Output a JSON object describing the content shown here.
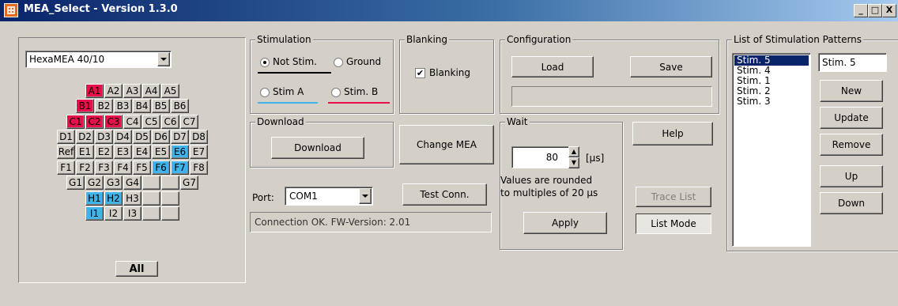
{
  "window": {
    "title": "MEA_Select - Version 1.3.0",
    "min": "_",
    "max": "□",
    "close": "X"
  },
  "mea": {
    "selected_type": "HexaMEA 40/10",
    "rows": [
      [
        {
          "label": "A1",
          "state": "stimB"
        },
        {
          "label": "A2",
          "state": "none"
        },
        {
          "label": "A3",
          "state": "none"
        },
        {
          "label": "A4",
          "state": "none"
        },
        {
          "label": "A5",
          "state": "none"
        }
      ],
      [
        {
          "label": "B1",
          "state": "stimB"
        },
        {
          "label": "B2",
          "state": "none"
        },
        {
          "label": "B3",
          "state": "none"
        },
        {
          "label": "B4",
          "state": "none"
        },
        {
          "label": "B5",
          "state": "none"
        },
        {
          "label": "B6",
          "state": "none"
        }
      ],
      [
        {
          "label": "C1",
          "state": "stimB"
        },
        {
          "label": "C2",
          "state": "stimB"
        },
        {
          "label": "C3",
          "state": "stimB"
        },
        {
          "label": "C4",
          "state": "none"
        },
        {
          "label": "C5",
          "state": "none"
        },
        {
          "label": "C6",
          "state": "none"
        },
        {
          "label": "C7",
          "state": "none"
        }
      ],
      [
        {
          "label": "D1",
          "state": "none"
        },
        {
          "label": "D2",
          "state": "none"
        },
        {
          "label": "D3",
          "state": "none"
        },
        {
          "label": "D4",
          "state": "none"
        },
        {
          "label": "D5",
          "state": "none"
        },
        {
          "label": "D6",
          "state": "none"
        },
        {
          "label": "D7",
          "state": "none"
        },
        {
          "label": "D8",
          "state": "none"
        }
      ],
      [
        {
          "label": "Ref",
          "state": "none"
        },
        {
          "label": "E1",
          "state": "none"
        },
        {
          "label": "E2",
          "state": "none"
        },
        {
          "label": "E3",
          "state": "none"
        },
        {
          "label": "E4",
          "state": "none"
        },
        {
          "label": "E5",
          "state": "none"
        },
        {
          "label": "E6",
          "state": "stimA"
        },
        {
          "label": "E7",
          "state": "none"
        }
      ],
      [
        {
          "label": "F1",
          "state": "none"
        },
        {
          "label": "F2",
          "state": "none"
        },
        {
          "label": "F3",
          "state": "none"
        },
        {
          "label": "F4",
          "state": "none"
        },
        {
          "label": "F5",
          "state": "none"
        },
        {
          "label": "F6",
          "state": "stimA"
        },
        {
          "label": "F7",
          "state": "stimA"
        },
        {
          "label": "F8",
          "state": "none"
        }
      ],
      [
        {
          "label": "G1",
          "state": "none"
        },
        {
          "label": "G2",
          "state": "none"
        },
        {
          "label": "G3",
          "state": "none"
        },
        {
          "label": "G4",
          "state": "none"
        },
        {
          "label": "",
          "state": "none"
        },
        {
          "label": "",
          "state": "none"
        },
        {
          "label": "G7",
          "state": "none"
        }
      ],
      [
        {
          "label": "H1",
          "state": "stimA"
        },
        {
          "label": "H2",
          "state": "stimA"
        },
        {
          "label": "H3",
          "state": "none"
        },
        {
          "label": "",
          "state": "none"
        },
        {
          "label": "",
          "state": "none"
        }
      ],
      [
        {
          "label": "I1",
          "state": "stimA"
        },
        {
          "label": "I2",
          "state": "none"
        },
        {
          "label": "I3",
          "state": "none"
        },
        {
          "label": "",
          "state": "none"
        },
        {
          "label": "",
          "state": "none"
        }
      ]
    ],
    "all_label": "All"
  },
  "stimulation": {
    "title": "Stimulation",
    "not_stim": "Not Stim.",
    "ground": "Ground",
    "stim_a": "Stim A",
    "stim_b": "Stim. B",
    "colors": {
      "stim_a": "#3fb3ea",
      "stim_b": "#e8104a",
      "not_stim": "#000000"
    }
  },
  "blanking": {
    "title": "Blanking",
    "checkbox_label": "Blanking",
    "checked": true
  },
  "configuration": {
    "title": "Configuration",
    "load": "Load",
    "save": "Save",
    "path": ""
  },
  "download": {
    "title": "Download",
    "button": "Download"
  },
  "change_mea": "Change MEA",
  "port": {
    "label": "Port:",
    "value": "COM1",
    "test_button": "Test Conn.",
    "status": "Connection OK. FW-Version: 2.01"
  },
  "wait": {
    "title": "Wait",
    "value": "80",
    "unit": "[µs]",
    "note_line1": "Values are rounded",
    "note_line2": "to multiples of 20 µs",
    "apply": "Apply"
  },
  "help": "Help",
  "trace_list": "Trace List",
  "list_mode": "List Mode",
  "patterns": {
    "title": "List of Stimulation Patterns",
    "items": [
      "Stim. 5",
      "Stim. 4",
      "Stim. 1",
      "Stim. 2",
      "Stim. 3"
    ],
    "selected_index": 0,
    "name_value": "Stim. 5",
    "new": "New",
    "update": "Update",
    "remove": "Remove",
    "up": "Up",
    "down": "Down"
  }
}
